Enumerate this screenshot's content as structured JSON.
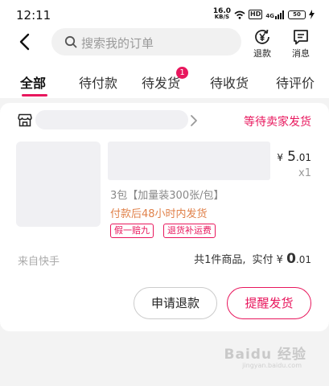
{
  "status_bar": {
    "time": "12:11",
    "net_speed": "16.0",
    "net_unit": "KB/S",
    "hd": "HD",
    "signal": "4G",
    "battery": "50"
  },
  "header": {
    "search_placeholder": "搜索我的订单",
    "refund_label": "退款",
    "message_label": "消息"
  },
  "tabs": [
    {
      "label": "全部",
      "active": true
    },
    {
      "label": "待付款"
    },
    {
      "label": "待发货",
      "badge": "1"
    },
    {
      "label": "待收货"
    },
    {
      "label": "待评价"
    }
  ],
  "order": {
    "status": "等待卖家发货",
    "price_currency": "¥",
    "price_int": "5",
    "price_dec": ".01",
    "quantity": "x1",
    "spec": "3包【加量装300张/包】",
    "ship_note": "付款后48小时内发货",
    "tags": [
      "假一赔九",
      "退货补运费"
    ],
    "source": "来自快手",
    "total_count": "共1件商品,",
    "paid_label": "实付",
    "paid_currency": "¥",
    "paid_int": "0",
    "paid_dec": ".01",
    "buttons": {
      "refund": "申请退款",
      "remind": "提醒发货"
    }
  },
  "watermark": {
    "text": "Baidu 经验",
    "sub": "jingyan.baidu.com"
  },
  "colors": {
    "accent": "#e8175d",
    "ship_note": "#e0824b",
    "background": "#f3f3f3"
  },
  "icons": [
    "back-arrow-icon",
    "search-icon",
    "refund-yen-icon",
    "message-icon",
    "store-icon",
    "chevron-right-icon"
  ]
}
